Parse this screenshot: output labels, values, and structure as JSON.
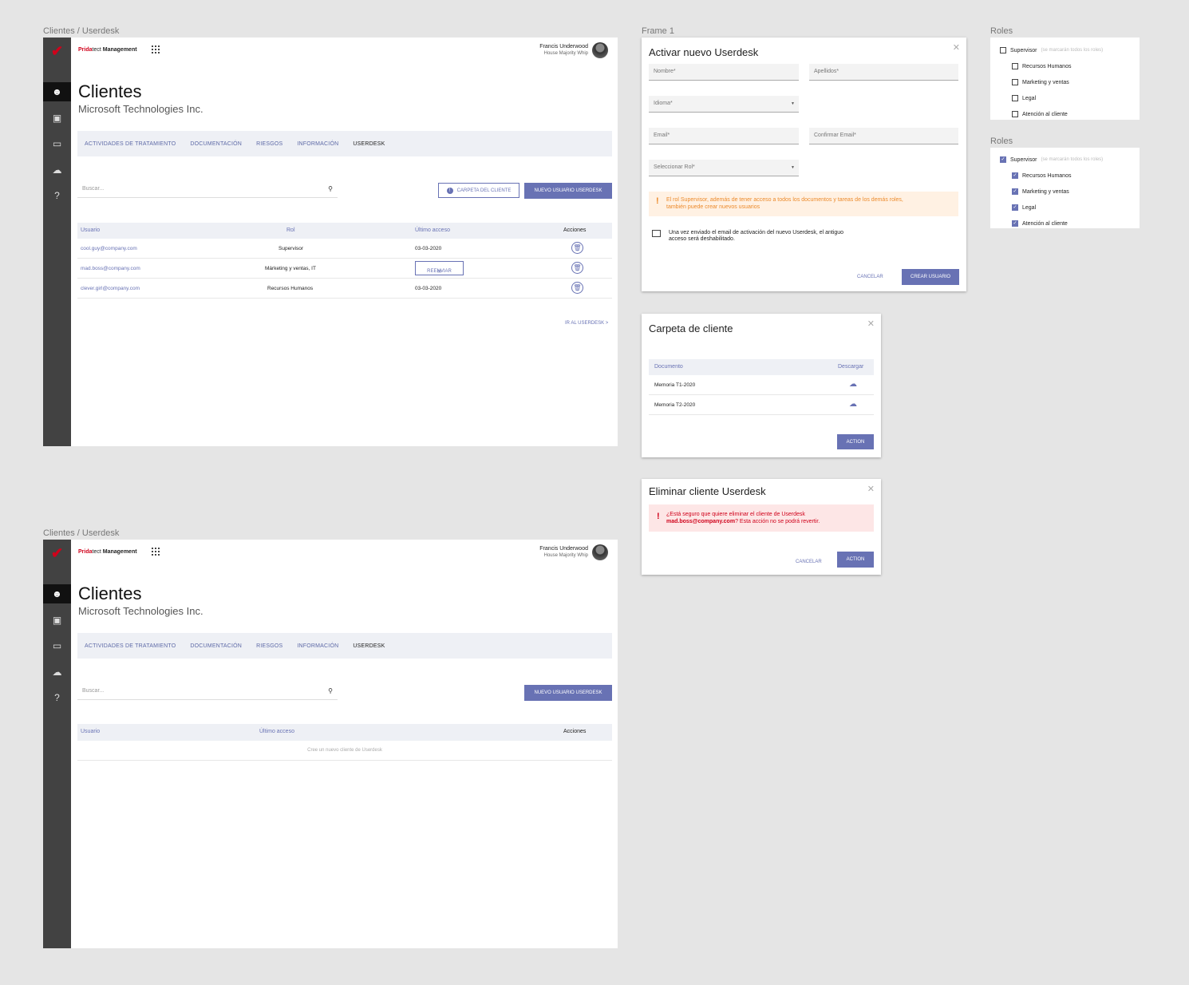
{
  "labels": {
    "frame_a": "Clientes / Userdesk",
    "frame_b": "Frame 1",
    "frame_c": "Clientes / Userdesk",
    "roles1": "Roles",
    "roles2": "Roles"
  },
  "app": {
    "brand_red": "Prida",
    "brand_mid": "tect",
    "brand_bold": "Management",
    "user_name": "Francis Underwood",
    "user_role": "House Majority Whip"
  },
  "page": {
    "title": "Clientes",
    "subtitle": "Microsoft Technologies Inc.",
    "tabs": [
      "ACTIVIDADES DE TRATAMIENTO",
      "DOCUMENTACIÓN",
      "RIESGOS",
      "INFORMACIÓN",
      "USERDESK"
    ],
    "search_placeholder": "Buscar...",
    "folder_button": "CARPETA DEL CLIENTE",
    "new_user_button": "NUEVO USUARIO USERDESK",
    "go_userdesk": "IR AL USERDESK >"
  },
  "table": {
    "headers": [
      "Usuario",
      "Rol",
      "Último acceso",
      "Acciones"
    ],
    "rows": [
      {
        "user": "cool.guy@company.com",
        "role": "Supervisor",
        "last": "03-03-2020"
      },
      {
        "user": "mad.boss@company.com",
        "role": "Márketing y ventas, IT",
        "last": "REENVIAR"
      },
      {
        "user": "clever.girl@company.com",
        "role": "Recursos Humanos",
        "last": "03-03-2020"
      }
    ]
  },
  "empty_table": {
    "headers": [
      "Usuario",
      "Último acceso",
      "Acciones"
    ],
    "empty_msg": "Cree un nuevo cliente de Userdesk"
  },
  "activate_modal": {
    "title": "Activar nuevo Userdesk",
    "nombre": "Nombre*",
    "apellidos": "Apellidos*",
    "idioma": "Idioma*",
    "email": "Email*",
    "confirm_email": "Confirmar Email*",
    "rol": "Seleccionar Rol*",
    "warning_1": "El rol Supervisor, además de tener acceso a todos los documentos y tareas de los demás roles,",
    "warning_2": "también puede crear nuevos usuarios",
    "check_1": "Una vez enviado el email de activación del nuevo Userdesk, el antiguo",
    "check_2": "acceso será deshabilitado.",
    "cancel": "CANCELAR",
    "create": "CREAR USUARIO"
  },
  "folder_modal": {
    "title": "Carpeta de cliente",
    "col_doc": "Documento",
    "col_dl": "Descargar",
    "docs": [
      "Memoria T1-2020",
      "Memoria T2-2020"
    ],
    "action": "ACTION"
  },
  "delete_modal": {
    "title": "Eliminar cliente Userdesk",
    "msg_1": "¿Está seguro que quiere eliminar el cliente de Userdesk",
    "msg_email": "mad.boss@company.com",
    "msg_2": "? Esta acción no se podrá revertir.",
    "cancel": "CANCELAR",
    "action": "ACTION"
  },
  "roles": {
    "supervisor": "Supervisor",
    "hint": "(se marcarán todos los roles)",
    "items": [
      "Recursos Humanos",
      "Marketing y ventas",
      "Legal",
      "Atención al cliente"
    ]
  },
  "colors": {
    "accent": "#6872b4",
    "sidebar": "#424242",
    "brand": "#d0021b"
  }
}
